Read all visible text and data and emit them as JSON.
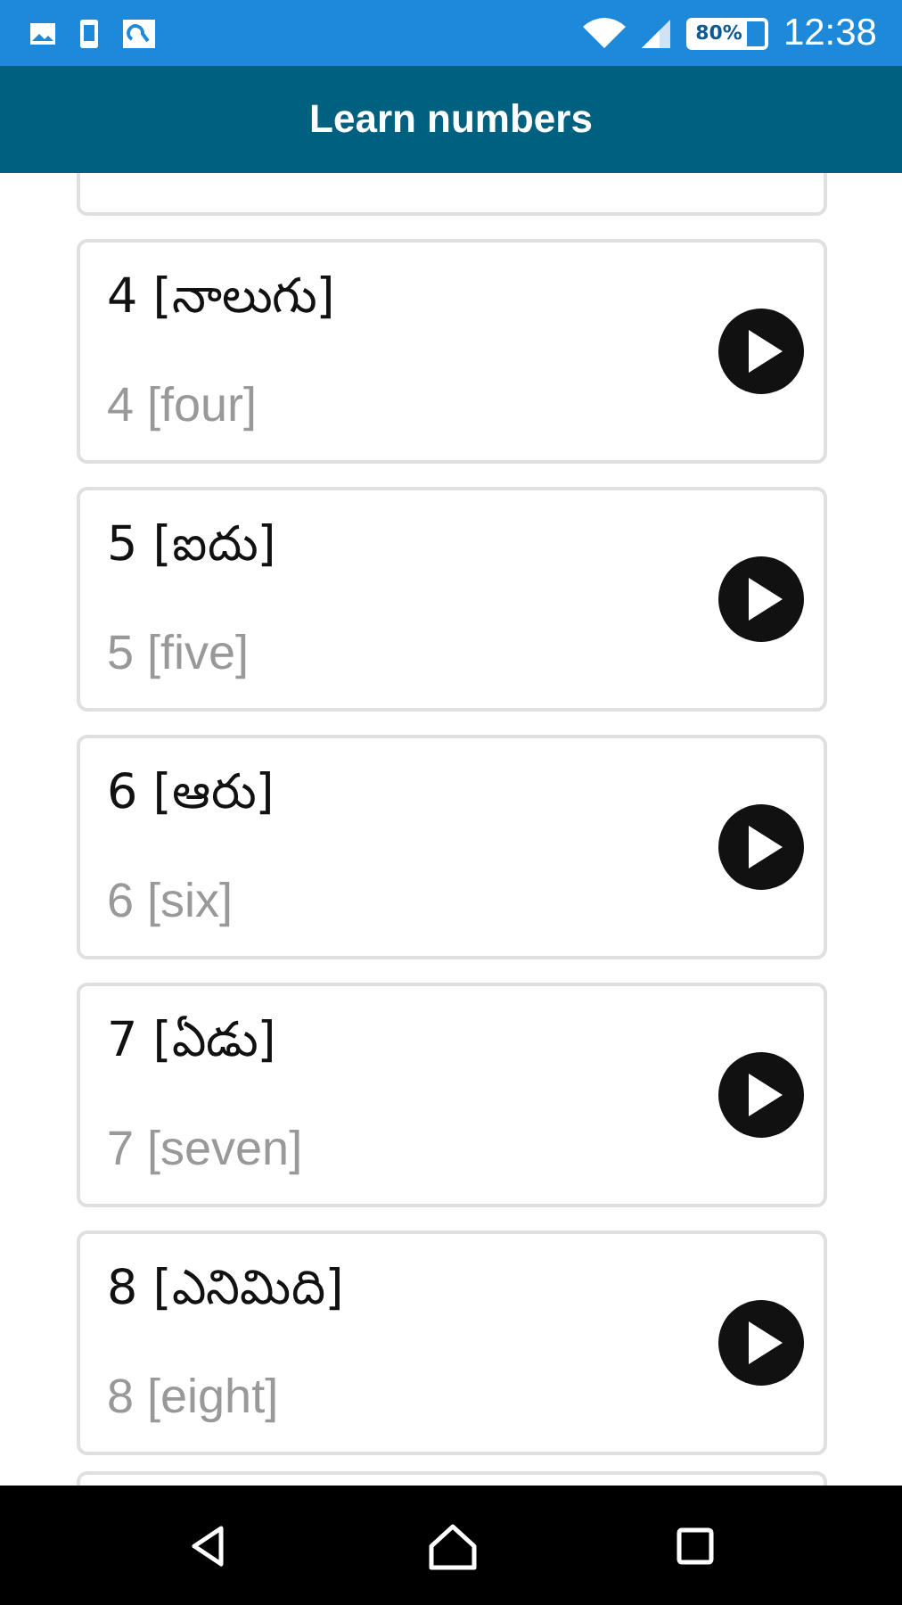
{
  "status_bar": {
    "battery": "80%",
    "time": "12:38"
  },
  "app_bar": {
    "title": "Learn numbers"
  },
  "items": [
    {
      "native": "4 [నాలుగు]",
      "english": "4 [four]"
    },
    {
      "native": "5 [ఐదు]",
      "english": "5 [five]"
    },
    {
      "native": "6 [ఆరు]",
      "english": "6 [six]"
    },
    {
      "native": "7 [ఏడు]",
      "english": "7 [seven]"
    },
    {
      "native": "8 [ఎనిమిది]",
      "english": "8 [eight]"
    }
  ]
}
